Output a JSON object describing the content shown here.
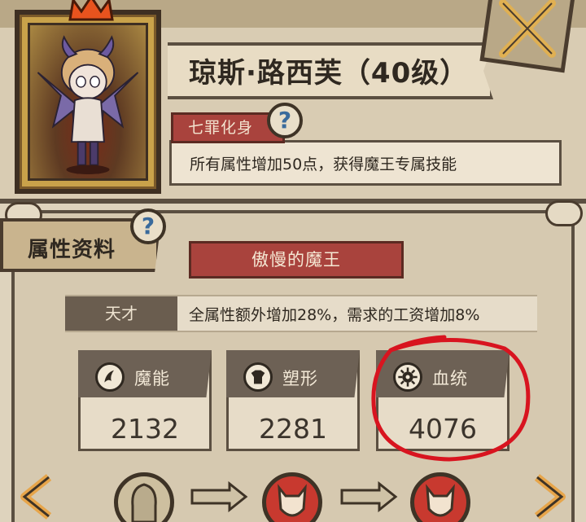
{
  "character": {
    "name_title": "琼斯·路西芙（40级）"
  },
  "trait": {
    "label": "七罪化身",
    "description": "所有属性增加50点，获得魔王专属技能",
    "help_glyph": "?"
  },
  "attributes": {
    "tab_label": "属性资料",
    "help_glyph": "?",
    "class_name": "傲慢的魔王",
    "talent_label": "天才",
    "talent_description": "全属性额外增加28%，需求的工资增加8%",
    "stats": [
      {
        "label": "魔能",
        "value": "2132",
        "icon": "magic-claw-icon"
      },
      {
        "label": "塑形",
        "value": "2281",
        "icon": "muscle-body-icon"
      },
      {
        "label": "血统",
        "value": "4076",
        "icon": "bloodline-gear-icon"
      }
    ]
  },
  "colors": {
    "accent_red": "#a9433d",
    "panel": "#d6c9b0",
    "border": "#5b4f41",
    "highlight_circle": "#d8141f"
  }
}
